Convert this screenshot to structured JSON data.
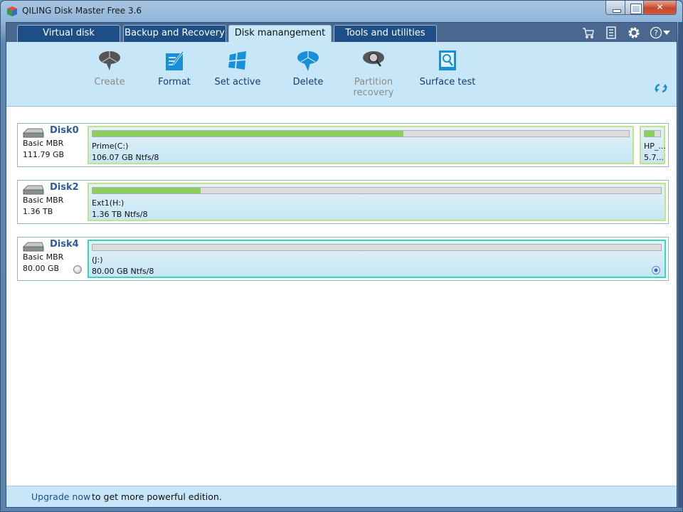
{
  "window": {
    "title": "QILING Disk Master Free 3.6",
    "controls": {
      "minimize": "minimize",
      "maximize": "maximize",
      "close": "close"
    }
  },
  "tabs": [
    {
      "label": "Virtual disk",
      "active": false
    },
    {
      "label": "Backup and Recovery",
      "active": false
    },
    {
      "label": "Disk manangement",
      "active": true
    },
    {
      "label": "Tools and utilities",
      "active": false
    }
  ],
  "header_icons": [
    "cart-icon",
    "notes-icon",
    "gear-icon",
    "help-icon"
  ],
  "toolbar": {
    "items": [
      {
        "label": "Create",
        "icon": "create-partition-icon",
        "enabled": false
      },
      {
        "label": "Format",
        "icon": "format-icon",
        "enabled": true
      },
      {
        "label": "Set active",
        "icon": "windows-logo-icon",
        "enabled": true
      },
      {
        "label": "Delete",
        "icon": "delete-partition-icon",
        "enabled": true
      },
      {
        "label": "Partition recovery",
        "label_line1": "Partition",
        "label_line2": "recovery",
        "icon": "partition-recovery-icon",
        "enabled": false
      },
      {
        "label": "Surface test",
        "icon": "surface-test-icon",
        "enabled": true
      }
    ],
    "refresh_icon": "refresh-icon"
  },
  "disks": [
    {
      "name": "Disk0",
      "type": "Basic MBR",
      "size": "111.79 GB",
      "selected": false,
      "partitions": [
        {
          "name": "Prime(C:)",
          "size": "106.07 GB Ntfs/8",
          "used_fraction": 0.58,
          "selected": false
        },
        {
          "name": "HP_...",
          "size": "5.7...",
          "used_fraction": 0.65,
          "selected": false
        }
      ]
    },
    {
      "name": "Disk2",
      "type": "Basic MBR",
      "size": "1.36 TB",
      "selected": false,
      "partitions": [
        {
          "name": "Ext1(H:)",
          "size": "1.36 TB Ntfs/8",
          "used_fraction": 0.19,
          "selected": false
        }
      ]
    },
    {
      "name": "Disk4",
      "type": "Basic MBR",
      "size": "80.00 GB",
      "selected": false,
      "partitions": [
        {
          "name": "(J:)",
          "size": "80.00 GB Ntfs/8",
          "used_fraction": 0.0,
          "selected": true
        }
      ]
    }
  ],
  "status": {
    "upgrade_link": "Upgrade now",
    "message": "to get more powerful edition."
  },
  "colors": {
    "accent": "#1d4f86",
    "toolbar_bg": "#c7e6f8",
    "used_bar": "#8dcf5f",
    "selected_border": "#34d9b7",
    "partition_border": "#c5e289"
  }
}
